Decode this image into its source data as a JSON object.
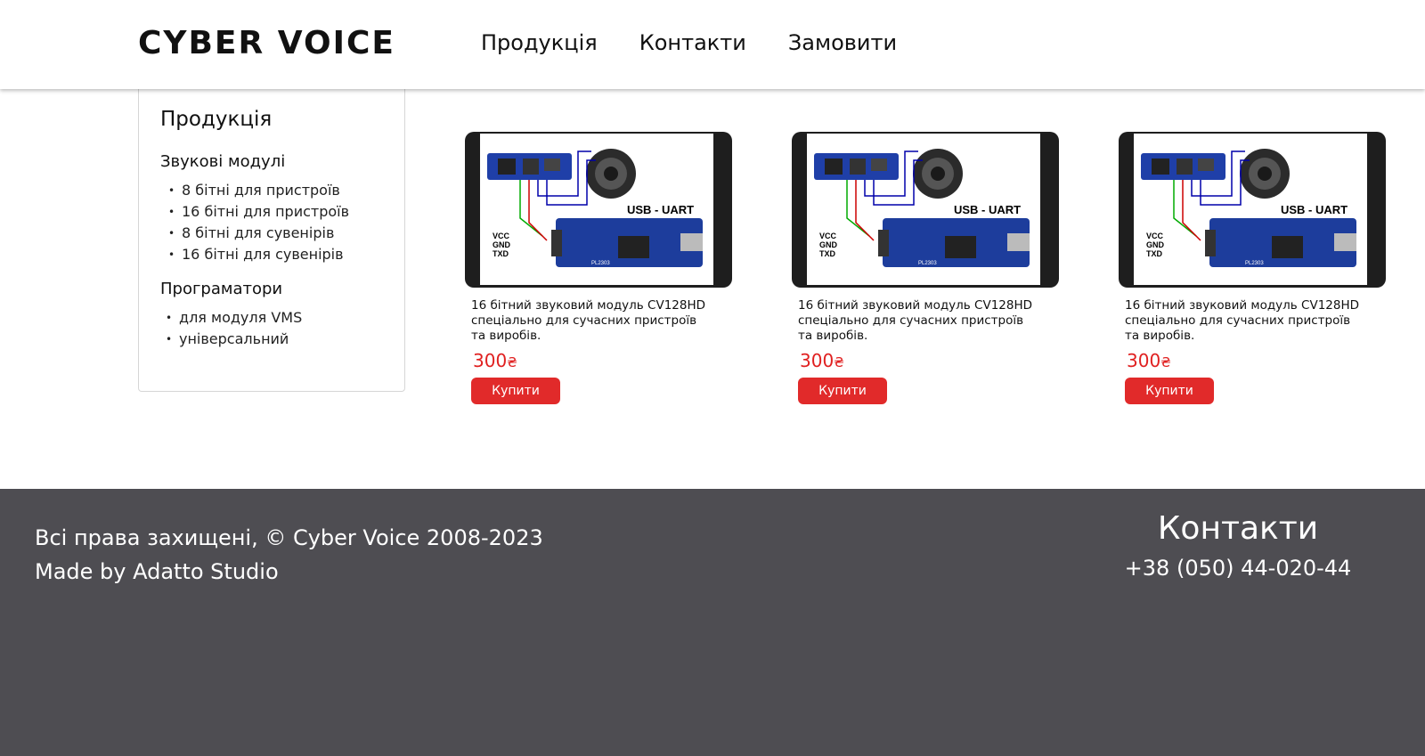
{
  "header": {
    "logo": "CYBER VOICE",
    "nav": [
      "Продукція",
      "Контакти",
      "Замовити"
    ]
  },
  "sidebar": {
    "title": "Продукція",
    "sections": [
      {
        "title": "Звукові модулі",
        "items": [
          "8 бітні для пристроїв",
          "16 бітні для пристроїв",
          "8 бітні для сувенірів",
          "16 бітні для сувенірів"
        ]
      },
      {
        "title": "Програматори",
        "items": [
          "для модуля VMS",
          "універсальний"
        ]
      }
    ]
  },
  "products": [
    {
      "description": "16 бітний звуковий модуль CV128HD спеціально для сучасних пристроїв та виробів.",
      "price": "300",
      "currency": "₴",
      "buy_label": "Купити",
      "image_labels": {
        "title": "USB - UART",
        "pins": [
          "VCC",
          "GND",
          "TXD"
        ],
        "chip": "PL2303"
      }
    },
    {
      "description": "16 бітний звуковий модуль CV128HD спеціально для сучасних пристроїв та виробів.",
      "price": "300",
      "currency": "₴",
      "buy_label": "Купити",
      "image_labels": {
        "title": "USB - UART",
        "pins": [
          "VCC",
          "GND",
          "TXD"
        ],
        "chip": "PL2303"
      }
    },
    {
      "description": "16 бітний звуковий модуль CV128HD спеціально для сучасних пристроїв та виробів.",
      "price": "300",
      "currency": "₴",
      "buy_label": "Купити",
      "image_labels": {
        "title": "USB - UART",
        "pins": [
          "VCC",
          "GND",
          "TXD"
        ],
        "chip": "PL2303"
      }
    }
  ],
  "footer": {
    "copyright": "Всі права захищені, © Cyber Voice 2008-2023",
    "made_by": "Made by Adatto Studio",
    "contacts_title": "Контакти",
    "phone": "+38 (050) 44-020-44"
  },
  "colors": {
    "accent": "#e12a2a",
    "footer_bg": "#4e4d52",
    "card_frame": "#1e1e1e"
  }
}
